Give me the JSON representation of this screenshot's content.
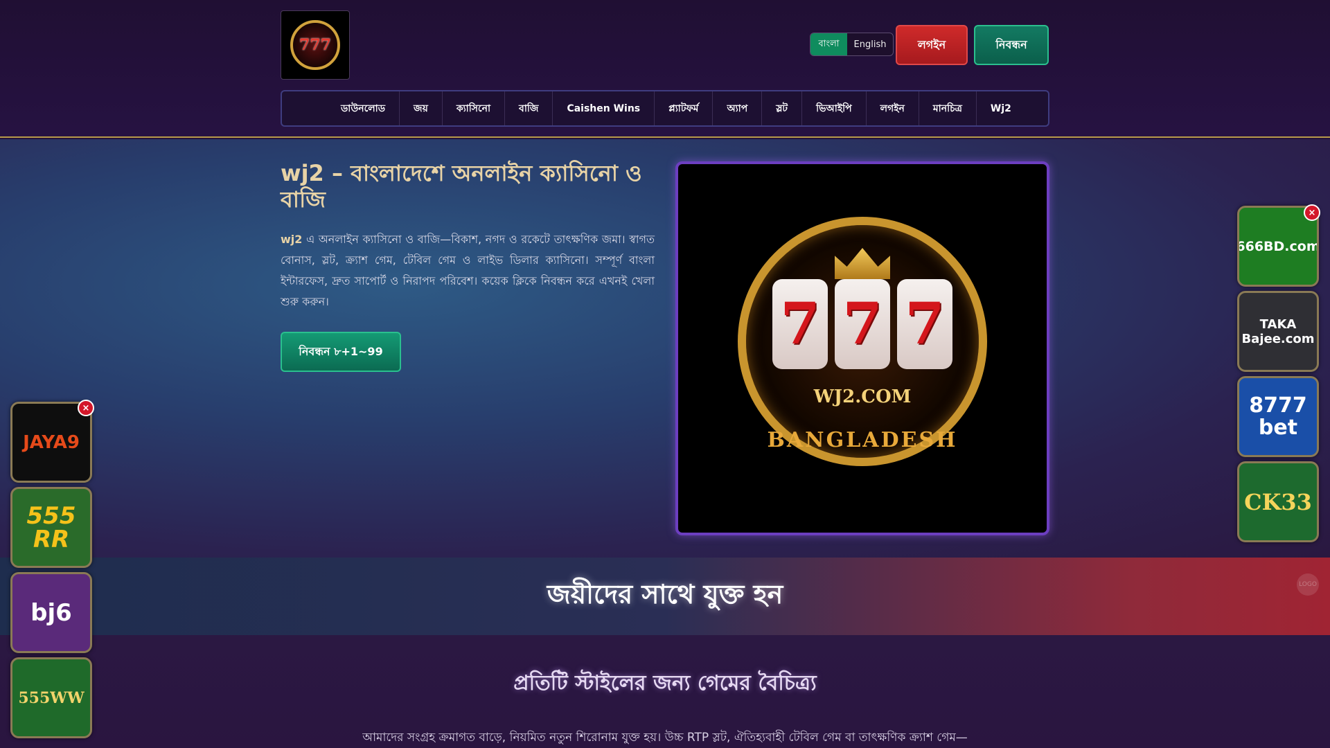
{
  "header": {
    "logo_alt": "777 WJ2 Bangladesh",
    "logo_digits": "777",
    "lang": {
      "active": "বাংলা",
      "inactive": "English"
    },
    "login_label": "লগইন",
    "register_label": "নিবন্ধন"
  },
  "nav": [
    "ডাউনলোড",
    "জয়",
    "ক্যাসিনো",
    "বাজি",
    "Caishen Wins",
    "প্ল্যাটফর্ম",
    "অ্যাপ",
    "স্লট",
    "ভিআইপি",
    "লগইন",
    "মানচিত্র",
    "Wj2"
  ],
  "hero": {
    "title": "wj2 – বাংলাদেশে অনলাইন ক্যাসিনো ও বাজি",
    "desc_brand": "wj2",
    "desc_rest": " এ অনলাইন ক্যাসিনো ও বাজি—বিকাশ, নগদ ও রকেটে তাৎক্ষণিক জমা। স্বাগত বোনাস, স্লট, ক্র্যাশ গেম, টেবিল গেম ও লাইভ ডিলার ক্যাসিনো। সম্পূর্ণ বাংলা ইন্টারফেস, দ্রুত সাপোর্ট ও নিরাপদ পরিবেশ। কয়েক ক্লিকে নিবন্ধন করে এখনই খেলা শুরু করুন।",
    "cta_label": "নিবন্ধন ৮+1~99",
    "image": {
      "brand": "WJ2.COM",
      "country": "BANGLADESH",
      "slots": [
        "7",
        "7",
        "7"
      ]
    }
  },
  "join": {
    "title": "জয়ীদের সাথে যুক্ত হন",
    "badge": "LOGO"
  },
  "variety": {
    "title": "প্রতিটি স্টাইলের জন্য গেমের বৈচিত্র্য",
    "desc": "আমাদের সংগ্রহ ক্রমাগত বাড়ে, নিয়মিত নতুন শিরোনাম যুক্ত হয়। উচ্চ RTP স্লট, ঐতিহ্যবাহী টেবিল গেম বা তাৎক্ষণিক ক্র্যাশ গেম—"
  },
  "ads_left": [
    {
      "name": "JAYA9",
      "color": "#e64a1a",
      "bg": "#0e0e0e"
    },
    {
      "name": "555 RR",
      "color": "#f5c21a",
      "bg": "#2a6b2a"
    },
    {
      "name": "bj6",
      "color": "#ffffff",
      "bg": "#5a2a7a"
    },
    {
      "name": "555WW",
      "color": "#f2d36b",
      "bg": "#1f6a2a"
    }
  ],
  "ads_right": [
    {
      "name": "666BD.com",
      "color": "#ffffff",
      "bg": "#1e7d22"
    },
    {
      "name": "TAKA Bajee.com",
      "color": "#ffffff",
      "bg": "#2f2f34"
    },
    {
      "name": "8777 bet",
      "color": "#ffffff",
      "bg": "#1a4fa8"
    },
    {
      "name": "CK33",
      "color": "#f5d45b",
      "bg": "#1d6a2e"
    }
  ],
  "close_symbol": "×",
  "colors": {
    "accent_gold": "#e8d3a6",
    "login_red": "#cf2a2a",
    "register_green": "#0f8c5e",
    "nav_border": "#3f3d80",
    "hero_frame": "#6c3ec0"
  }
}
